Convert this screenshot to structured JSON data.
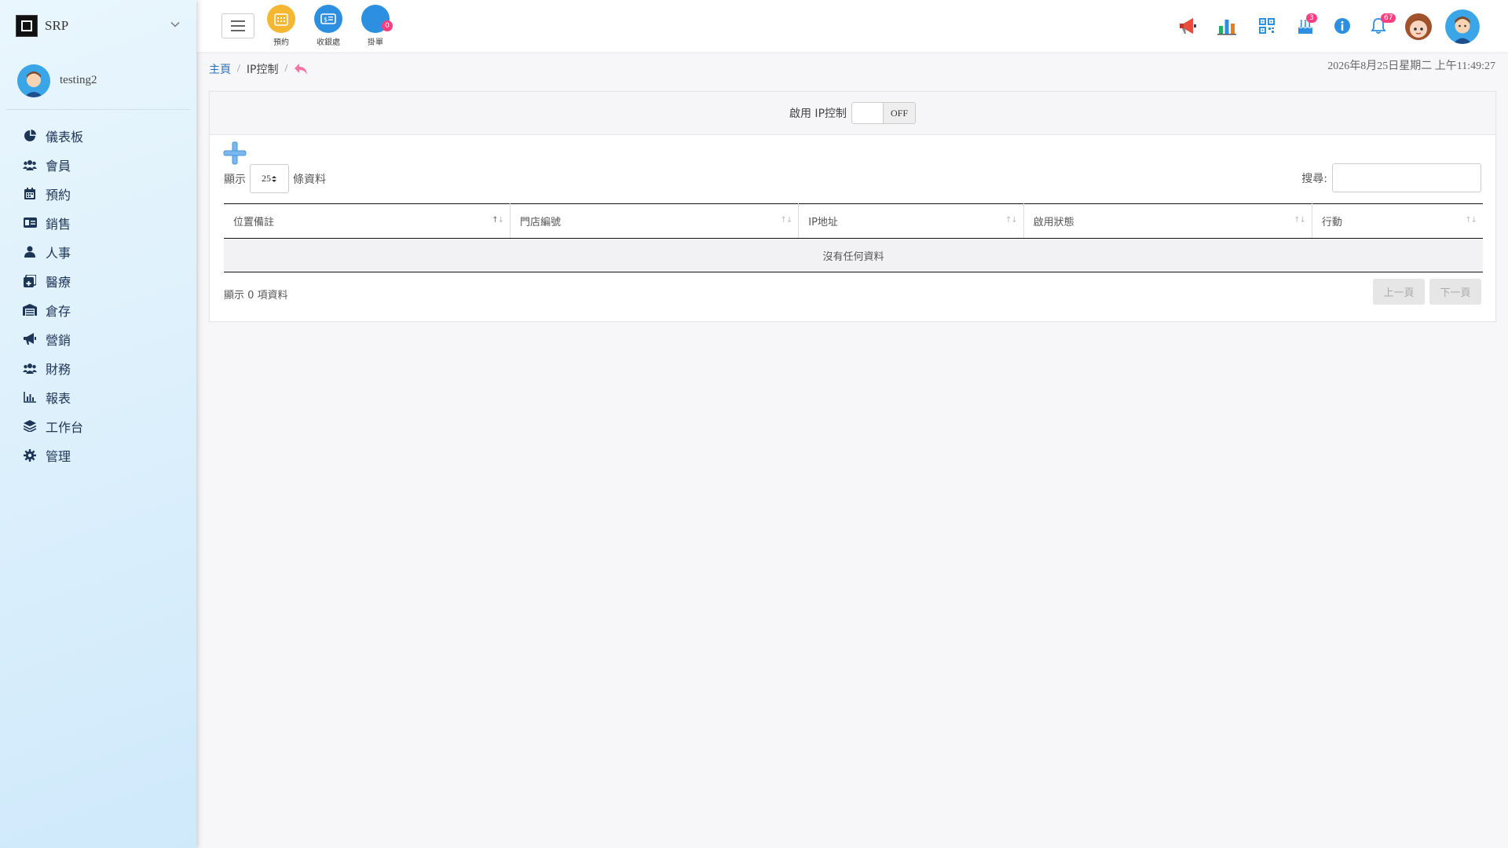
{
  "app": {
    "name": "SRP"
  },
  "user": {
    "name": "testing2"
  },
  "sidebar": {
    "items": [
      {
        "label": "儀表板",
        "icon": "pie-chart-icon"
      },
      {
        "label": "會員",
        "icon": "users-icon"
      },
      {
        "label": "預約",
        "icon": "calendar-icon"
      },
      {
        "label": "銷售",
        "icon": "money-card-icon"
      },
      {
        "label": "人事",
        "icon": "person-icon"
      },
      {
        "label": "醫療",
        "icon": "medical-icon"
      },
      {
        "label": "倉存",
        "icon": "warehouse-icon"
      },
      {
        "label": "營銷",
        "icon": "megaphone-icon"
      },
      {
        "label": "財務",
        "icon": "users-icon"
      },
      {
        "label": "報表",
        "icon": "bar-chart-icon"
      },
      {
        "label": "工作台",
        "icon": "layers-icon"
      },
      {
        "label": "管理",
        "icon": "gear-icon"
      }
    ]
  },
  "topbar": {
    "quick": [
      {
        "label": "預約",
        "icon": "calendar-icon",
        "color": "#f5b731"
      },
      {
        "label": "收銀處",
        "icon": "cashier-icon",
        "color": "#2d8fe0"
      },
      {
        "label": "掛單",
        "icon": "circle-icon",
        "color": "#2d8fe0",
        "badge": "0"
      }
    ],
    "tools": [
      {
        "icon": "megaphone-icon"
      },
      {
        "icon": "bar-chart-icon"
      },
      {
        "icon": "qr-code-icon"
      },
      {
        "icon": "birthday-cake-icon",
        "badge": "3"
      },
      {
        "icon": "info-icon"
      },
      {
        "icon": "bell-icon",
        "badge": "67"
      }
    ]
  },
  "breadcrumb": {
    "home": "主頁",
    "current": "IP控制"
  },
  "datetime": "2026年8月25日星期二 上午11:49:27",
  "ip_control": {
    "label": "啟用 IP控制",
    "toggle_value": "OFF"
  },
  "table_controls": {
    "show_prefix": "顯示",
    "page_length": "25",
    "show_suffix": "條資料",
    "search_label": "搜尋:",
    "search_value": ""
  },
  "table": {
    "columns": [
      "位置備註",
      "門店編號",
      "IP地址",
      "啟用狀態",
      "行動"
    ],
    "empty_text": "沒有任何資料",
    "info": "顯示 0 項資料"
  },
  "pagination": {
    "prev": "上一頁",
    "next": "下一頁"
  },
  "colors": {
    "accent": "#2d8fe0",
    "badge": "#ff3d7f",
    "menu_text": "#1d3557"
  }
}
